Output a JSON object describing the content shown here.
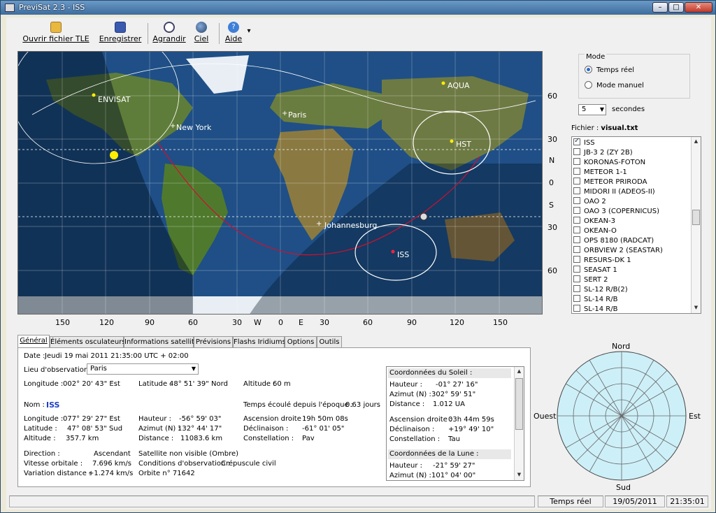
{
  "window": {
    "title": "PreviSat 2.3 - ISS",
    "buttons": {
      "minimize": "–",
      "maximize": "□",
      "close": "✕"
    }
  },
  "toolbar": {
    "items": [
      {
        "label": "Ouvrir fichier TLE",
        "icon": "folder-open-icon"
      },
      {
        "label": "Enregistrer",
        "icon": "save-icon"
      },
      {
        "label": "Agrandir",
        "icon": "zoom-icon"
      },
      {
        "label": "Ciel",
        "icon": "globe-icon"
      },
      {
        "label": "Aide",
        "icon": "help-icon"
      }
    ],
    "dropdown_arrow": "▾"
  },
  "map": {
    "cities": [
      "Paris",
      "New York",
      "Johannesburg"
    ],
    "satellites": [
      "ISS",
      "HST",
      "AQUA",
      "ENVISAT"
    ],
    "lat_labels": [
      "60",
      "30",
      "N",
      "0",
      "S",
      "30",
      "60"
    ],
    "lon_labels": [
      "150",
      "120",
      "90",
      "60",
      "30",
      "W",
      "0",
      "E",
      "30",
      "60",
      "90",
      "120",
      "150"
    ],
    "colors": {
      "ocean": "#1f4f86",
      "land": "#5f7d3a",
      "track": "#d01030",
      "footprint": "#ffffff",
      "sun": "#ffee00"
    }
  },
  "mode": {
    "legend": "Mode",
    "options": [
      {
        "label": "Temps réel",
        "selected": true
      },
      {
        "label": "Mode manuel",
        "selected": false
      }
    ]
  },
  "interval": {
    "value": "5",
    "unit": "secondes"
  },
  "file": {
    "label": "Fichier :",
    "name": "visual.txt"
  },
  "satlist": {
    "items": [
      {
        "name": "ISS",
        "checked": true
      },
      {
        "name": "JB-3 2 (ZY 2B)",
        "checked": false
      },
      {
        "name": "KORONAS-FOTON",
        "checked": false
      },
      {
        "name": "METEOR 1-1",
        "checked": false
      },
      {
        "name": "METEOR PRIRODA",
        "checked": false
      },
      {
        "name": "MIDORI II (ADEOS-II)",
        "checked": false
      },
      {
        "name": "OAO 2",
        "checked": false
      },
      {
        "name": "OAO 3 (COPERNICUS)",
        "checked": false
      },
      {
        "name": "OKEAN-3",
        "checked": false
      },
      {
        "name": "OKEAN-O",
        "checked": false
      },
      {
        "name": "OPS 8180 (RADCAT)",
        "checked": false
      },
      {
        "name": "ORBVIEW 2 (SEASTAR)",
        "checked": false
      },
      {
        "name": "RESURS-DK 1",
        "checked": false
      },
      {
        "name": "SEASAT 1",
        "checked": false
      },
      {
        "name": "SERT 2",
        "checked": false
      },
      {
        "name": "SL-12 R/B(2)",
        "checked": false
      },
      {
        "name": "SL-14 R/B",
        "checked": false
      },
      {
        "name": "SL-14 R/B",
        "checked": false
      }
    ]
  },
  "tabs": [
    {
      "label": "Général",
      "active": true
    },
    {
      "label": "Éléments osculateurs",
      "active": false
    },
    {
      "label": "Informations satellite",
      "active": false
    },
    {
      "label": "Prévisions",
      "active": false
    },
    {
      "label": "Flashs Iridiums",
      "active": false
    },
    {
      "label": "Options",
      "active": false
    },
    {
      "label": "Outils",
      "active": false
    }
  ],
  "general": {
    "date_label": "Date :",
    "date_value": "Jeudi 19 mai 2011  21:35:00  UTC + 02:00",
    "lieu_label": "Lieu d'observation :",
    "lieu_value": "Paris",
    "longitude_label": "Longitude :",
    "longitude_value": "002° 20' 43\" Est",
    "latitude_label": "Latitude :",
    "latitude_value": "48° 51' 39\" Nord",
    "altitude_label": "Altitude :",
    "altitude_value": "60 m",
    "nom_label": "Nom :",
    "nom_value": "ISS",
    "epoque_label": "Temps écoulé depuis l'époque :",
    "epoque_value": "0.63 jours",
    "sat": {
      "longitude_label": "Longitude :",
      "longitude_value": "077° 29' 27\" Est",
      "latitude_label": "Latitude :",
      "latitude_value": "47° 08' 53\" Sud",
      "altitude_label": "Altitude :",
      "altitude_value": "357.7 km",
      "hauteur_label": "Hauteur :",
      "hauteur_value": "-56° 59' 03\"",
      "azimut_label": "Azimut (N) :",
      "azimut_value": "132° 44' 17\"",
      "distance_label": "Distance :",
      "distance_value": "11083.6 km",
      "ad_label": "Ascension droite :",
      "ad_value": "19h 50m 08s",
      "decl_label": "Déclinaison :",
      "decl_value": "-61° 01' 05\"",
      "const_label": "Constellation :",
      "const_value": "Pav",
      "direction_label": "Direction :",
      "direction_value": "Ascendant",
      "vitesse_label": "Vitesse orbitale :",
      "vitesse_value": "7.696 km/s",
      "variation_label": "Variation distance :",
      "variation_value": "+1.274 km/s",
      "visibilite": "Satellite non visible (Ombre)",
      "conditions_label": "Conditions d'observation :",
      "conditions_value": "Crépuscule civil",
      "orbite": "Orbite n° 71642"
    }
  },
  "sun": {
    "header": "Coordonnées du Soleil :",
    "hauteur_label": "Hauteur :",
    "hauteur_value": "-01° 27' 16\"",
    "azimut_label": "Azimut (N) :",
    "azimut_value": "302° 59' 51\"",
    "distance_label": "Distance :",
    "distance_value": "1.012 UA",
    "ad_label": "Ascension droite :",
    "ad_value": "03h 44m 59s",
    "decl_label": "Déclinaison :",
    "decl_value": "+19° 49' 10\"",
    "const_label": "Constellation :",
    "const_value": "Tau"
  },
  "moon": {
    "header": "Coordonnées de la Lune :",
    "hauteur_label": "Hauteur :",
    "hauteur_value": "-21° 59' 27\"",
    "azimut_label": "Azimut (N) :",
    "azimut_value": "101° 04' 00\""
  },
  "sky": {
    "north": "Nord",
    "south": "Sud",
    "east": "Est",
    "west": "Ouest"
  },
  "status": {
    "mode": "Temps réel",
    "date": "19/05/2011",
    "time": "21:35:01"
  }
}
